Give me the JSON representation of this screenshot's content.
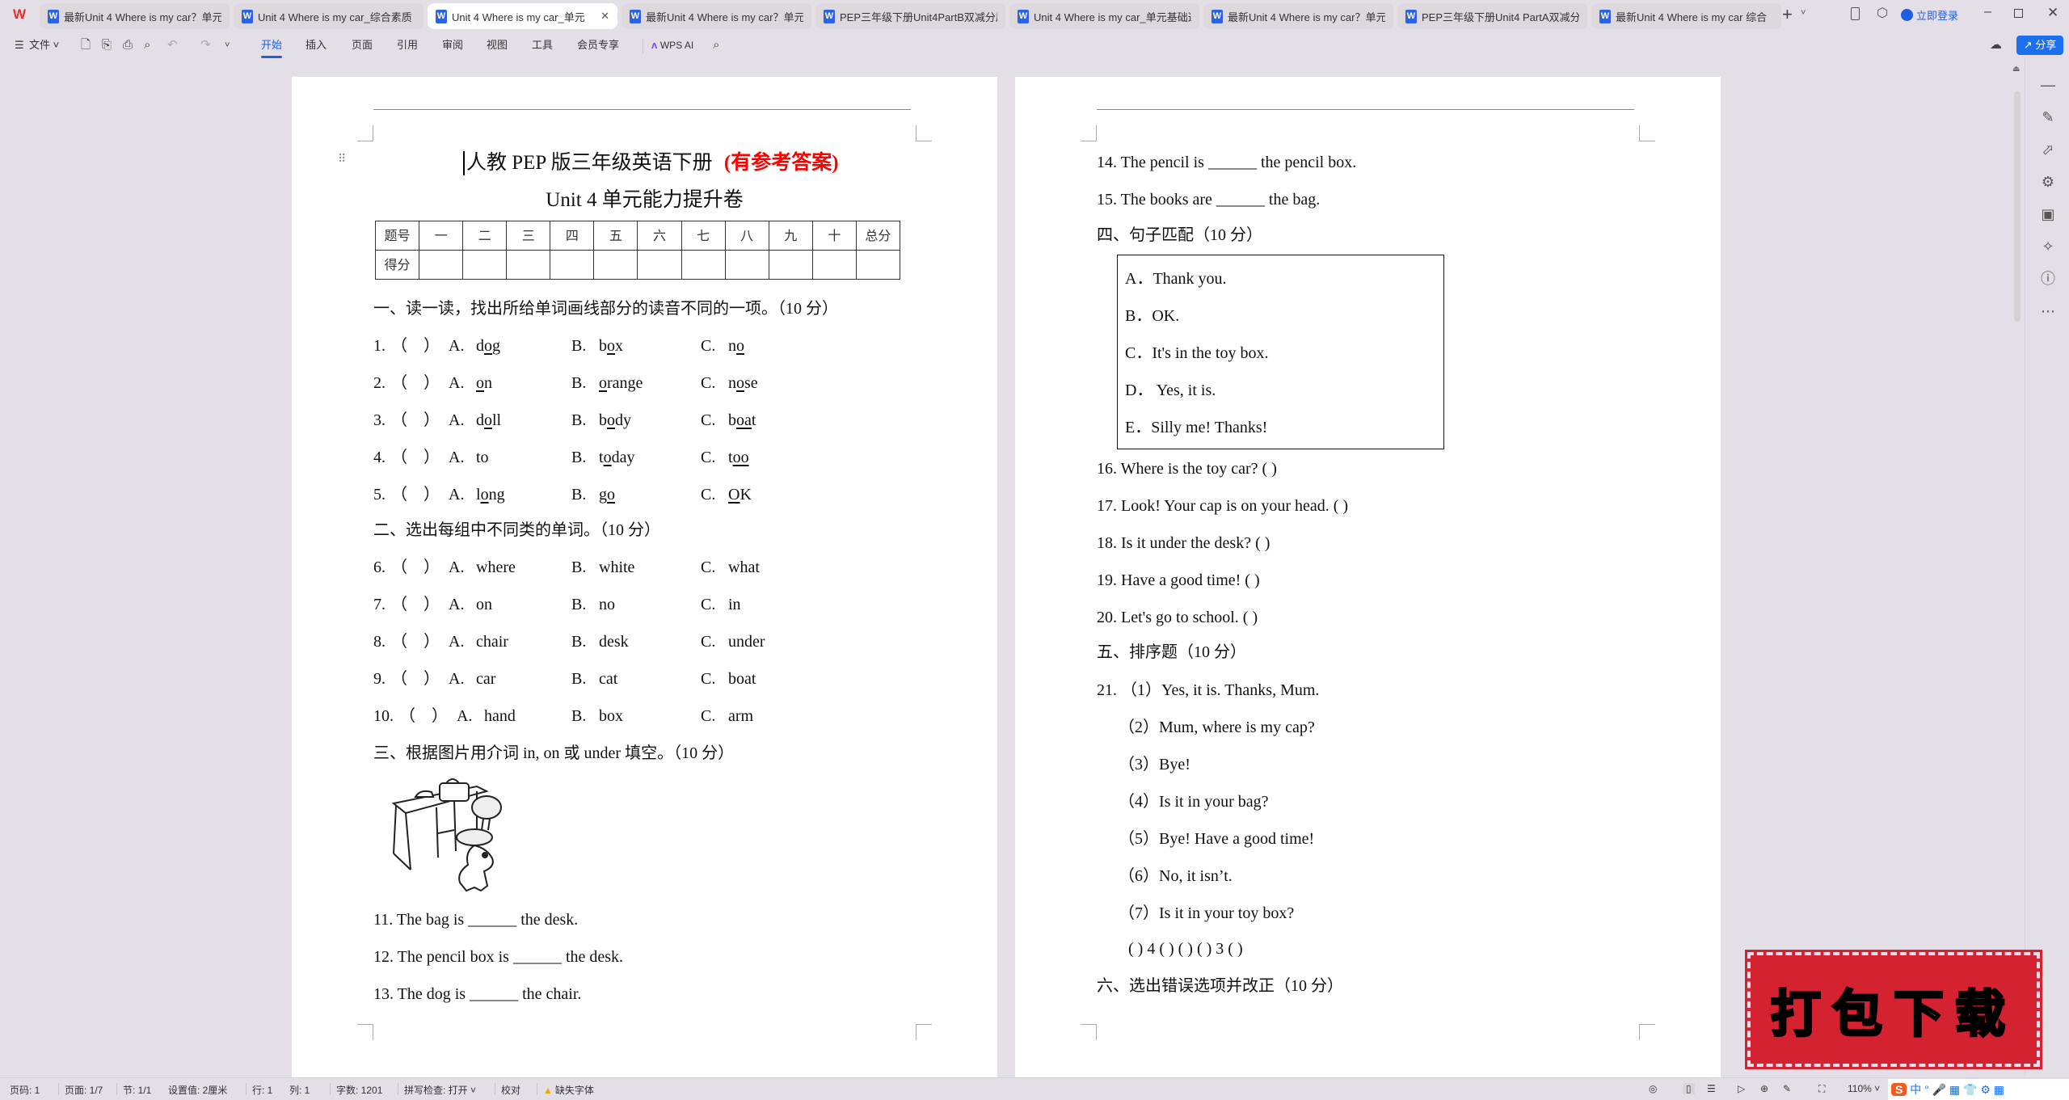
{
  "app": {
    "logo": "W",
    "new_tab": "+",
    "login": "立即登录",
    "share": "分享"
  },
  "tabs": [
    {
      "label": "最新Unit 4 Where is my car？单元",
      "active": false
    },
    {
      "label": "Unit 4 Where is my car_综合素质",
      "active": false
    },
    {
      "label": "Unit 4 Where is my car_单元",
      "active": true
    },
    {
      "label": "最新Unit 4 Where is my car？单元",
      "active": false
    },
    {
      "label": "PEP三年级下册Unit4PartB双减分层",
      "active": false
    },
    {
      "label": "Unit 4 Where is my car_单元基础达",
      "active": false
    },
    {
      "label": "最新Unit 4 Where is my car？单元",
      "active": false
    },
    {
      "label": "PEP三年级下册Unit4 PartA双减分层",
      "active": false
    },
    {
      "label": "最新Unit 4   Where is my car 综合",
      "active": false
    }
  ],
  "toolbar": {
    "file": "文件",
    "menus": [
      "开始",
      "插入",
      "页面",
      "引用",
      "审阅",
      "视图",
      "工具",
      "会员专享"
    ],
    "active_menu": "开始",
    "wps_ai": "WPS AI"
  },
  "doc": {
    "title_black": "人教 PEP 版三年级英语下册",
    "title_red": "(有参考答案)",
    "subtitle": "Unit 4 单元能力提升卷",
    "score_table": {
      "header": [
        "题号",
        "一",
        "二",
        "三",
        "四",
        "五",
        "六",
        "七",
        "八",
        "九",
        "十",
        "总分"
      ],
      "row2_label": "得分"
    },
    "section1": "一、读一读，找出所给单词画线部分的读音不同的一项。（10 分）",
    "q1_5": [
      {
        "n": "1.",
        "a": [
          "d",
          "o",
          "g"
        ],
        "b": [
          "b",
          "o",
          "x"
        ],
        "c": [
          "n",
          "o",
          ""
        ]
      },
      {
        "n": "2.",
        "a": [
          "",
          "o",
          "n"
        ],
        "b": [
          "",
          "o",
          "range"
        ],
        "c": [
          "n",
          "o",
          "se"
        ]
      },
      {
        "n": "3.",
        "a": [
          "d",
          "o",
          "ll"
        ],
        "b": [
          "b",
          "o",
          "dy"
        ],
        "c": [
          "b",
          "oa",
          "t"
        ]
      },
      {
        "n": "4.",
        "a": [
          "to",
          "",
          ""
        ],
        "b": [
          "t",
          "o",
          "day"
        ],
        "c": [
          "t",
          "oo",
          ""
        ]
      },
      {
        "n": "5.",
        "a": [
          "l",
          "o",
          "ng"
        ],
        "b": [
          "g",
          "o",
          ""
        ],
        "c": [
          "",
          "O",
          "K"
        ]
      }
    ],
    "section2": "二、选出每组中不同类的单词。（10 分）",
    "q6_10": [
      {
        "n": "6.",
        "a": "where",
        "b": "white",
        "c": "what"
      },
      {
        "n": "7.",
        "a": "on",
        "b": "no",
        "c": "in"
      },
      {
        "n": "8.",
        "a": "chair",
        "b": "desk",
        "c": "under"
      },
      {
        "n": "9.",
        "a": "car",
        "b": "cat",
        "c": "boat"
      },
      {
        "n": "10.",
        "a": "hand",
        "b": "box",
        "c": "arm"
      }
    ],
    "paren": "（　）",
    "labels": {
      "a": "A.",
      "b": "B.",
      "c": "C."
    },
    "section3": "三、根据图片用介词 in, on 或  under 填空。（10 分）",
    "q11_15": [
      "11.  The bag is ______ the desk.",
      "12.  The pencil box is ______ the desk.",
      "13.  The dog is ______ the chair.",
      "14.  The pencil is ______ the pencil box.",
      "15.  The books are ______ the bag."
    ],
    "section4": "四、句子匹配（10 分）",
    "match_options": [
      "A．Thank you.",
      "B．OK.",
      "C．It's in the toy box.",
      "D． Yes, it is.",
      "E．Silly me! Thanks!"
    ],
    "q16_20": [
      "16.  Where is the toy car? (         )",
      "17.  Look! Your cap is on your head. (         )",
      "18.  Is it under the desk? (         )",
      "19.  Have a good time! (         )",
      "20.  Let's go to school. (         )"
    ],
    "section5": "五、排序题（10 分）",
    "q21_lead": "21.  （1）Yes, it is. Thanks, Mum.",
    "q21_items": [
      "（2）Mum, where is my cap?",
      "（3）Bye!",
      "（4）Is it in your bag?",
      "（5）Bye! Have a good time!",
      "（6）No, it isn’t.",
      "（7）Is it in your toy box?"
    ],
    "q21_answer": "(          ) 4 (          ) (          ) (          ) 3 (          )",
    "section6": "六、选出错误选项并改正（10 分）"
  },
  "watermark": {
    "text": "打包下载",
    "bg": "#d42231",
    "fg": "#f5ff1a"
  },
  "status": {
    "items": [
      "页码: 1",
      "页面: 1/7",
      "节: 1/1",
      "设置值: 2厘米",
      "行: 1",
      "列: 1",
      "字数: 1201",
      "拼写检查: 打开 ˅",
      "校对",
      "缺失字体"
    ],
    "zoom": "110%"
  },
  "colors": {
    "accent": "#1d5fe0",
    "title_red": "#ff0000",
    "background": "#e4dee6"
  }
}
